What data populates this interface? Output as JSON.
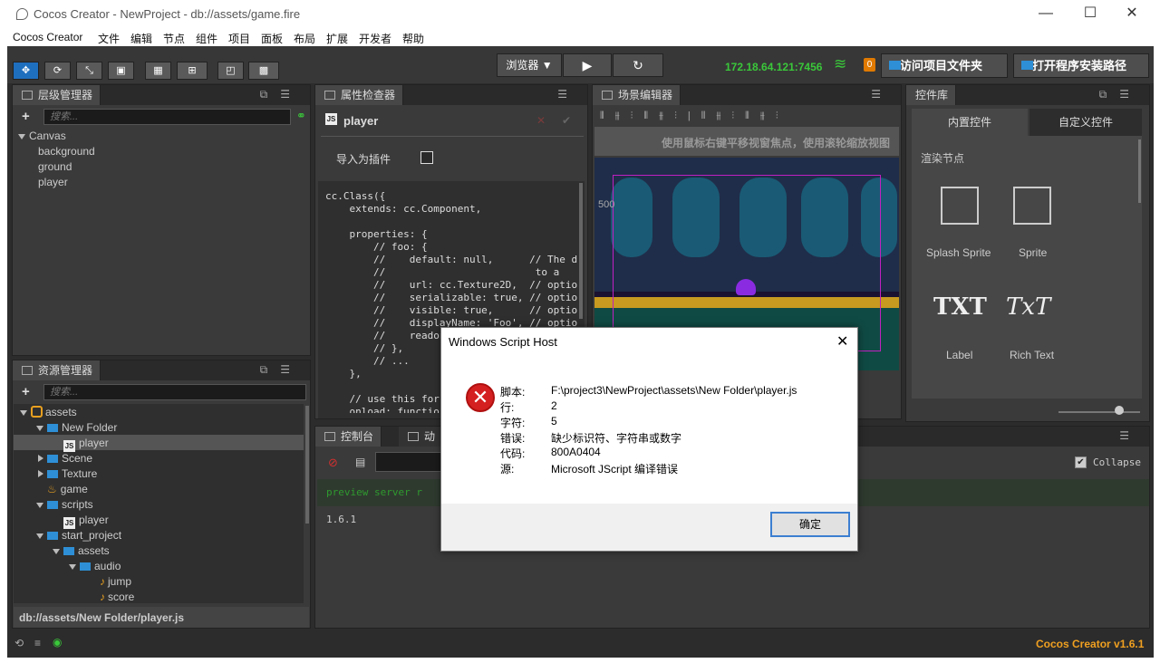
{
  "window": {
    "title": "Cocos Creator - NewProject - db://assets/game.fire"
  },
  "menu": [
    "Cocos Creator",
    "文件",
    "编辑",
    "节点",
    "组件",
    "项目",
    "面板",
    "布局",
    "扩展",
    "开发者",
    "帮助"
  ],
  "toolbar": {
    "browser_label": "浏览器",
    "ip": "172.18.64.121:7456",
    "badge": "0",
    "open_project_folder": "访问项目文件夹",
    "open_install_path": "打开程序安装路径"
  },
  "hierarchy": {
    "title": "层级管理器",
    "search_placeholder": "搜索...",
    "root": "Canvas",
    "children": [
      "background",
      "ground",
      "player"
    ]
  },
  "assets": {
    "title": "资源管理器",
    "search_placeholder": "搜索...",
    "items": [
      {
        "label": "assets",
        "depth": 0
      },
      {
        "label": "New Folder",
        "depth": 1
      },
      {
        "label": "player",
        "depth": 2
      },
      {
        "label": "Scene",
        "depth": 1
      },
      {
        "label": "Texture",
        "depth": 1
      },
      {
        "label": "game",
        "depth": 1
      },
      {
        "label": "scripts",
        "depth": 1
      },
      {
        "label": "player",
        "depth": 2
      },
      {
        "label": "start_project",
        "depth": 1
      },
      {
        "label": "assets",
        "depth": 2
      },
      {
        "label": "audio",
        "depth": 3
      },
      {
        "label": "jump",
        "depth": 4
      },
      {
        "label": "score",
        "depth": 4
      }
    ],
    "path": "db://assets/New Folder/player.js"
  },
  "inspector": {
    "title": "属性检查器",
    "file": "player",
    "import_as_plugin": "导入为插件",
    "code": "cc.Class({\n    extends: cc.Component,\n\n    properties: {\n        // foo: {\n        //    default: null,      // The d\n        //                         to a\n        //    url: cc.Texture2D,  // optio\n        //    serializable: true, // optio\n        //    visible: true,      // optio\n        //    displayName: 'Foo', // optio\n        //    readon\n        // },\n        // ...\n    },\n\n    // use this for\n    onload: functio"
  },
  "scene": {
    "title": "场景编辑器",
    "hint": "使用鼠标右键平移视窗焦点，使用滚轮缩放视图",
    "coord": "500"
  },
  "widgets": {
    "title": "控件库",
    "tabs": [
      "内置控件",
      "自定义控件"
    ],
    "section": "渲染节点",
    "items": [
      "Splash Sprite",
      "Sprite",
      "Label",
      "Rich Text"
    ],
    "txt1": "TXT",
    "txt2": "TxT"
  },
  "console": {
    "title": "控制台",
    "tab2": "动",
    "collapse": "Collapse",
    "line1": "preview server r",
    "line2": "1.6.1"
  },
  "dialog": {
    "title": "Windows Script Host",
    "rows": [
      {
        "k": "脚本:",
        "v": "F:\\project3\\NewProject\\assets\\New Folder\\player.js"
      },
      {
        "k": "行:",
        "v": "2"
      },
      {
        "k": "字符:",
        "v": "5"
      },
      {
        "k": "错误:",
        "v": "缺少标识符、字符串或数字"
      },
      {
        "k": "代码:",
        "v": "800A0404"
      },
      {
        "k": "源:",
        "v": "Microsoft JScript 编译错误"
      }
    ],
    "ok": "确定"
  },
  "status": {
    "version": "Cocos Creator v1.6.1"
  },
  "colors": {
    "accent": "#1f6fbf",
    "ip": "#3ac83a",
    "version": "#f0a020",
    "badge": "#e07a00"
  }
}
